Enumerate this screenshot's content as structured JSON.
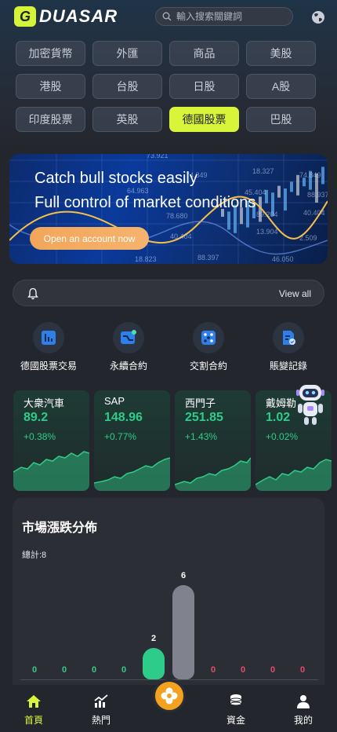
{
  "header": {
    "logo_mark": "G",
    "logo_text": "DUASAR",
    "search_placeholder": "輸入搜索關鍵詞"
  },
  "categories": [
    {
      "label": "加密貨幣",
      "active": false
    },
    {
      "label": "外匯",
      "active": false
    },
    {
      "label": "商品",
      "active": false
    },
    {
      "label": "美股",
      "active": false
    },
    {
      "label": "港股",
      "active": false
    },
    {
      "label": "台股",
      "active": false
    },
    {
      "label": "日股",
      "active": false
    },
    {
      "label": "A股",
      "active": false
    },
    {
      "label": "印度股票",
      "active": false
    },
    {
      "label": "英股",
      "active": false
    },
    {
      "label": "德國股票",
      "active": true
    },
    {
      "label": "巴股",
      "active": false
    }
  ],
  "banner": {
    "line1": "Catch bull stocks easily",
    "line2": "Full control of market conditions",
    "button": "Open an account now",
    "grid_numbers": [
      "73.921",
      "18.327",
      "74.849",
      "64.963",
      "89.204",
      "40.404",
      "78.680",
      "13.904",
      "40.404",
      "2.509",
      "88.397",
      "46.050",
      "18.823",
      "88.937",
      "74.849",
      "45.404"
    ]
  },
  "notice": {
    "view_all": "View all"
  },
  "actions": [
    {
      "label": "德國股票交易",
      "icon": "chart-bar-icon"
    },
    {
      "label": "永續合約",
      "icon": "trend-chart-icon"
    },
    {
      "label": "交割合約",
      "icon": "dice-icon"
    },
    {
      "label": "賬變記錄",
      "icon": "record-icon"
    }
  ],
  "stocks": [
    {
      "name": "大衆汽車",
      "price": "89.2",
      "change": "+0.38%"
    },
    {
      "name": "SAP",
      "price": "148.96",
      "change": "+0.77%"
    },
    {
      "name": "西門子",
      "price": "251.85",
      "change": "+1.43%"
    },
    {
      "name": "戴姆勒",
      "price": "1.02",
      "change": "+0.02%"
    }
  ],
  "market": {
    "title": "市場漲跌分佈",
    "total": "總計:8",
    "buckets": [
      {
        "value": "0",
        "count": 0,
        "color": "#2ecc8a"
      },
      {
        "value": "0",
        "count": 0,
        "color": "#2ecc8a"
      },
      {
        "value": "0",
        "count": 0,
        "color": "#2ecc8a"
      },
      {
        "value": "0",
        "count": 0,
        "color": "#2ecc8a"
      },
      {
        "value": "2",
        "count": 2,
        "color": "#2ecc8a"
      },
      {
        "value": "6",
        "count": 6,
        "color": "#80838e"
      },
      {
        "value": "0",
        "count": 0,
        "color": "#e84a6a"
      },
      {
        "value": "0",
        "count": 0,
        "color": "#e84a6a"
      },
      {
        "value": "0",
        "count": 0,
        "color": "#e84a6a"
      },
      {
        "value": "0",
        "count": 0,
        "color": "#e84a6a"
      }
    ]
  },
  "tabbar": [
    {
      "label": "首頁",
      "icon": "home-icon",
      "active": true
    },
    {
      "label": "熱門",
      "icon": "trending-icon",
      "active": false
    },
    {
      "label": "資金",
      "icon": "coins-icon",
      "active": false
    },
    {
      "label": "我的",
      "icon": "user-icon",
      "active": false
    }
  ],
  "colors": {
    "accent": "#d8f53a",
    "up": "#2ecc8a",
    "down": "#e84a6a",
    "orange": "#f2a21e"
  }
}
